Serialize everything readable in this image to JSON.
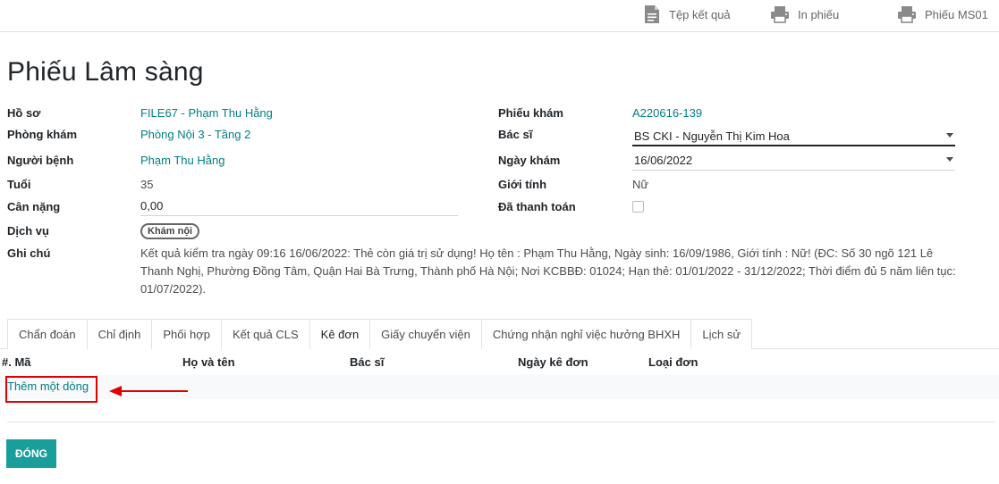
{
  "toolbar": {
    "file_label": "Tệp kết quả",
    "print_label": "In phiếu",
    "ms01_label": "Phiếu MS01"
  },
  "page": {
    "title": "Phiếu Lâm sàng"
  },
  "left": {
    "ho_so_label": "Hồ sơ",
    "ho_so_value": "FILE67 - Phạm Thu Hằng",
    "phong_kham_label": "Phòng khám",
    "phong_kham_value": "Phòng Nội 3 - Tầng 2",
    "nguoi_benh_label": "Người bệnh",
    "nguoi_benh_value": "Phạm Thu Hằng",
    "tuoi_label": "Tuổi",
    "tuoi_value": "35",
    "can_nang_label": "Cân nặng",
    "can_nang_value": "0,00",
    "dich_vu_label": "Dịch vụ",
    "dich_vu_value": "Khám nội",
    "ghi_chu_label": "Ghi chú",
    "ghi_chu_value": "Kết quả kiểm tra ngày 09:16 16/06/2022: Thẻ còn giá trị sử dụng! Họ tên : Phạm Thu Hằng, Ngày sinh: 16/09/1986, Giới tính : Nữ! (ĐC: Số 30 ngõ 121 Lê Thanh Nghị, Phường Đồng Tâm, Quận Hai Bà Trưng, Thành phố Hà Nội; Nơi KCBBĐ: 01024; Hạn thẻ: 01/01/2022 - 31/12/2022; Thời điểm đủ 5 năm liên tục: 01/07/2022)."
  },
  "right": {
    "phieu_kham_label": "Phiếu khám",
    "phieu_kham_value": "A220616-139",
    "bac_si_label": "Bác sĩ",
    "bac_si_value": "BS CKI - Nguyễn Thị Kim Hoa",
    "ngay_kham_label": "Ngày khám",
    "ngay_kham_value": "16/06/2022",
    "gioi_tinh_label": "Giới tính",
    "gioi_tinh_value": "Nữ",
    "da_thanh_toan_label": "Đã thanh toán",
    "da_thanh_toan_checked": false
  },
  "tabs": [
    {
      "label": "Chẩn đoán"
    },
    {
      "label": "Chỉ định"
    },
    {
      "label": "Phối hợp"
    },
    {
      "label": "Kết quả CLS"
    },
    {
      "label": "Kê đơn"
    },
    {
      "label": "Giấy chuyển viện"
    },
    {
      "label": "Chứng nhận nghỉ việc hưởng BHXH"
    },
    {
      "label": "Lịch sử"
    }
  ],
  "active_tab": "Kê đơn",
  "table": {
    "headers": [
      "#. Mã",
      "Họ và tên",
      "Bác sĩ",
      "Ngày kê đơn",
      "Loại đơn"
    ],
    "add_line": "Thêm một dòng"
  },
  "footer": {
    "close_label": "ĐÓNG"
  },
  "colors": {
    "link": "#017e84",
    "primary": "#1a9e9c",
    "highlight": "#e00000"
  }
}
